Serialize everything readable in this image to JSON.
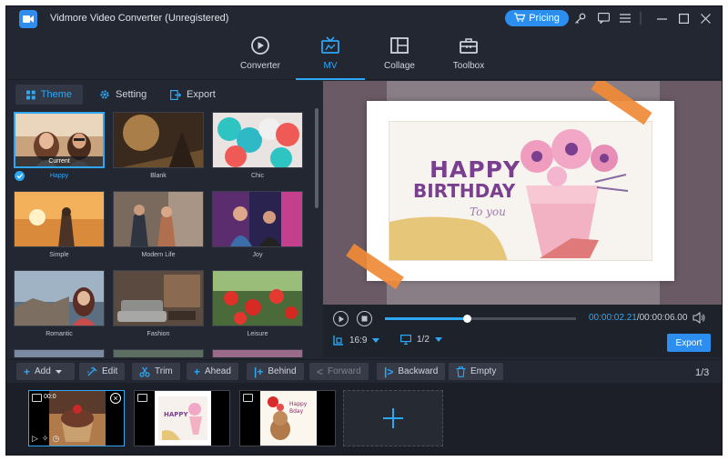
{
  "window": {
    "title": "Vidmore Video Converter (Unregistered)",
    "pricing_label": "Pricing"
  },
  "main_tabs": [
    {
      "label": "Converter",
      "icon": "converter-icon",
      "active": false
    },
    {
      "label": "MV",
      "icon": "mv-icon",
      "active": true
    },
    {
      "label": "Collage",
      "icon": "collage-icon",
      "active": false
    },
    {
      "label": "Toolbox",
      "icon": "toolbox-icon",
      "active": false
    }
  ],
  "sub_tabs": [
    {
      "label": "Theme",
      "icon": "grid-icon",
      "active": true
    },
    {
      "label": "Setting",
      "icon": "gear-icon",
      "active": false
    },
    {
      "label": "Export",
      "icon": "export-icon",
      "active": false
    }
  ],
  "themes": [
    {
      "name": "Happy",
      "selected": true,
      "badge": "Current"
    },
    {
      "name": "Blank",
      "selected": false
    },
    {
      "name": "Chic",
      "selected": false
    },
    {
      "name": "Simple",
      "selected": false
    },
    {
      "name": "Modern Life",
      "selected": false
    },
    {
      "name": "Joy",
      "selected": false
    },
    {
      "name": "Romantic",
      "selected": false
    },
    {
      "name": "Fashion",
      "selected": false
    },
    {
      "name": "Leisure",
      "selected": false
    }
  ],
  "preview": {
    "card_line1": "HAPPY",
    "card_line2": "BIRTHDAY",
    "card_line3": "To you"
  },
  "player": {
    "current_time": "00:00:02.21",
    "total_time": "/00:00:06.00",
    "progress": 0.43,
    "aspect_ratio": "16:9",
    "screen_page": "1/2",
    "export_label": "Export"
  },
  "toolbar": {
    "add": "Add",
    "edit": "Edit",
    "trim": "Trim",
    "ahead": "Ahead",
    "behind": "Behind",
    "forward": "Forward",
    "backward": "Backward",
    "empty": "Empty",
    "page_count": "1/3"
  },
  "clips": [
    {
      "duration": "00:0",
      "selected": true,
      "kind": "cupcake"
    },
    {
      "selected": false,
      "kind": "birthday-card"
    },
    {
      "selected": false,
      "kind": "bear-card"
    }
  ],
  "colors": {
    "accent": "#2ea7f5",
    "button_blue": "#2c8ff0",
    "background": "#232731"
  }
}
